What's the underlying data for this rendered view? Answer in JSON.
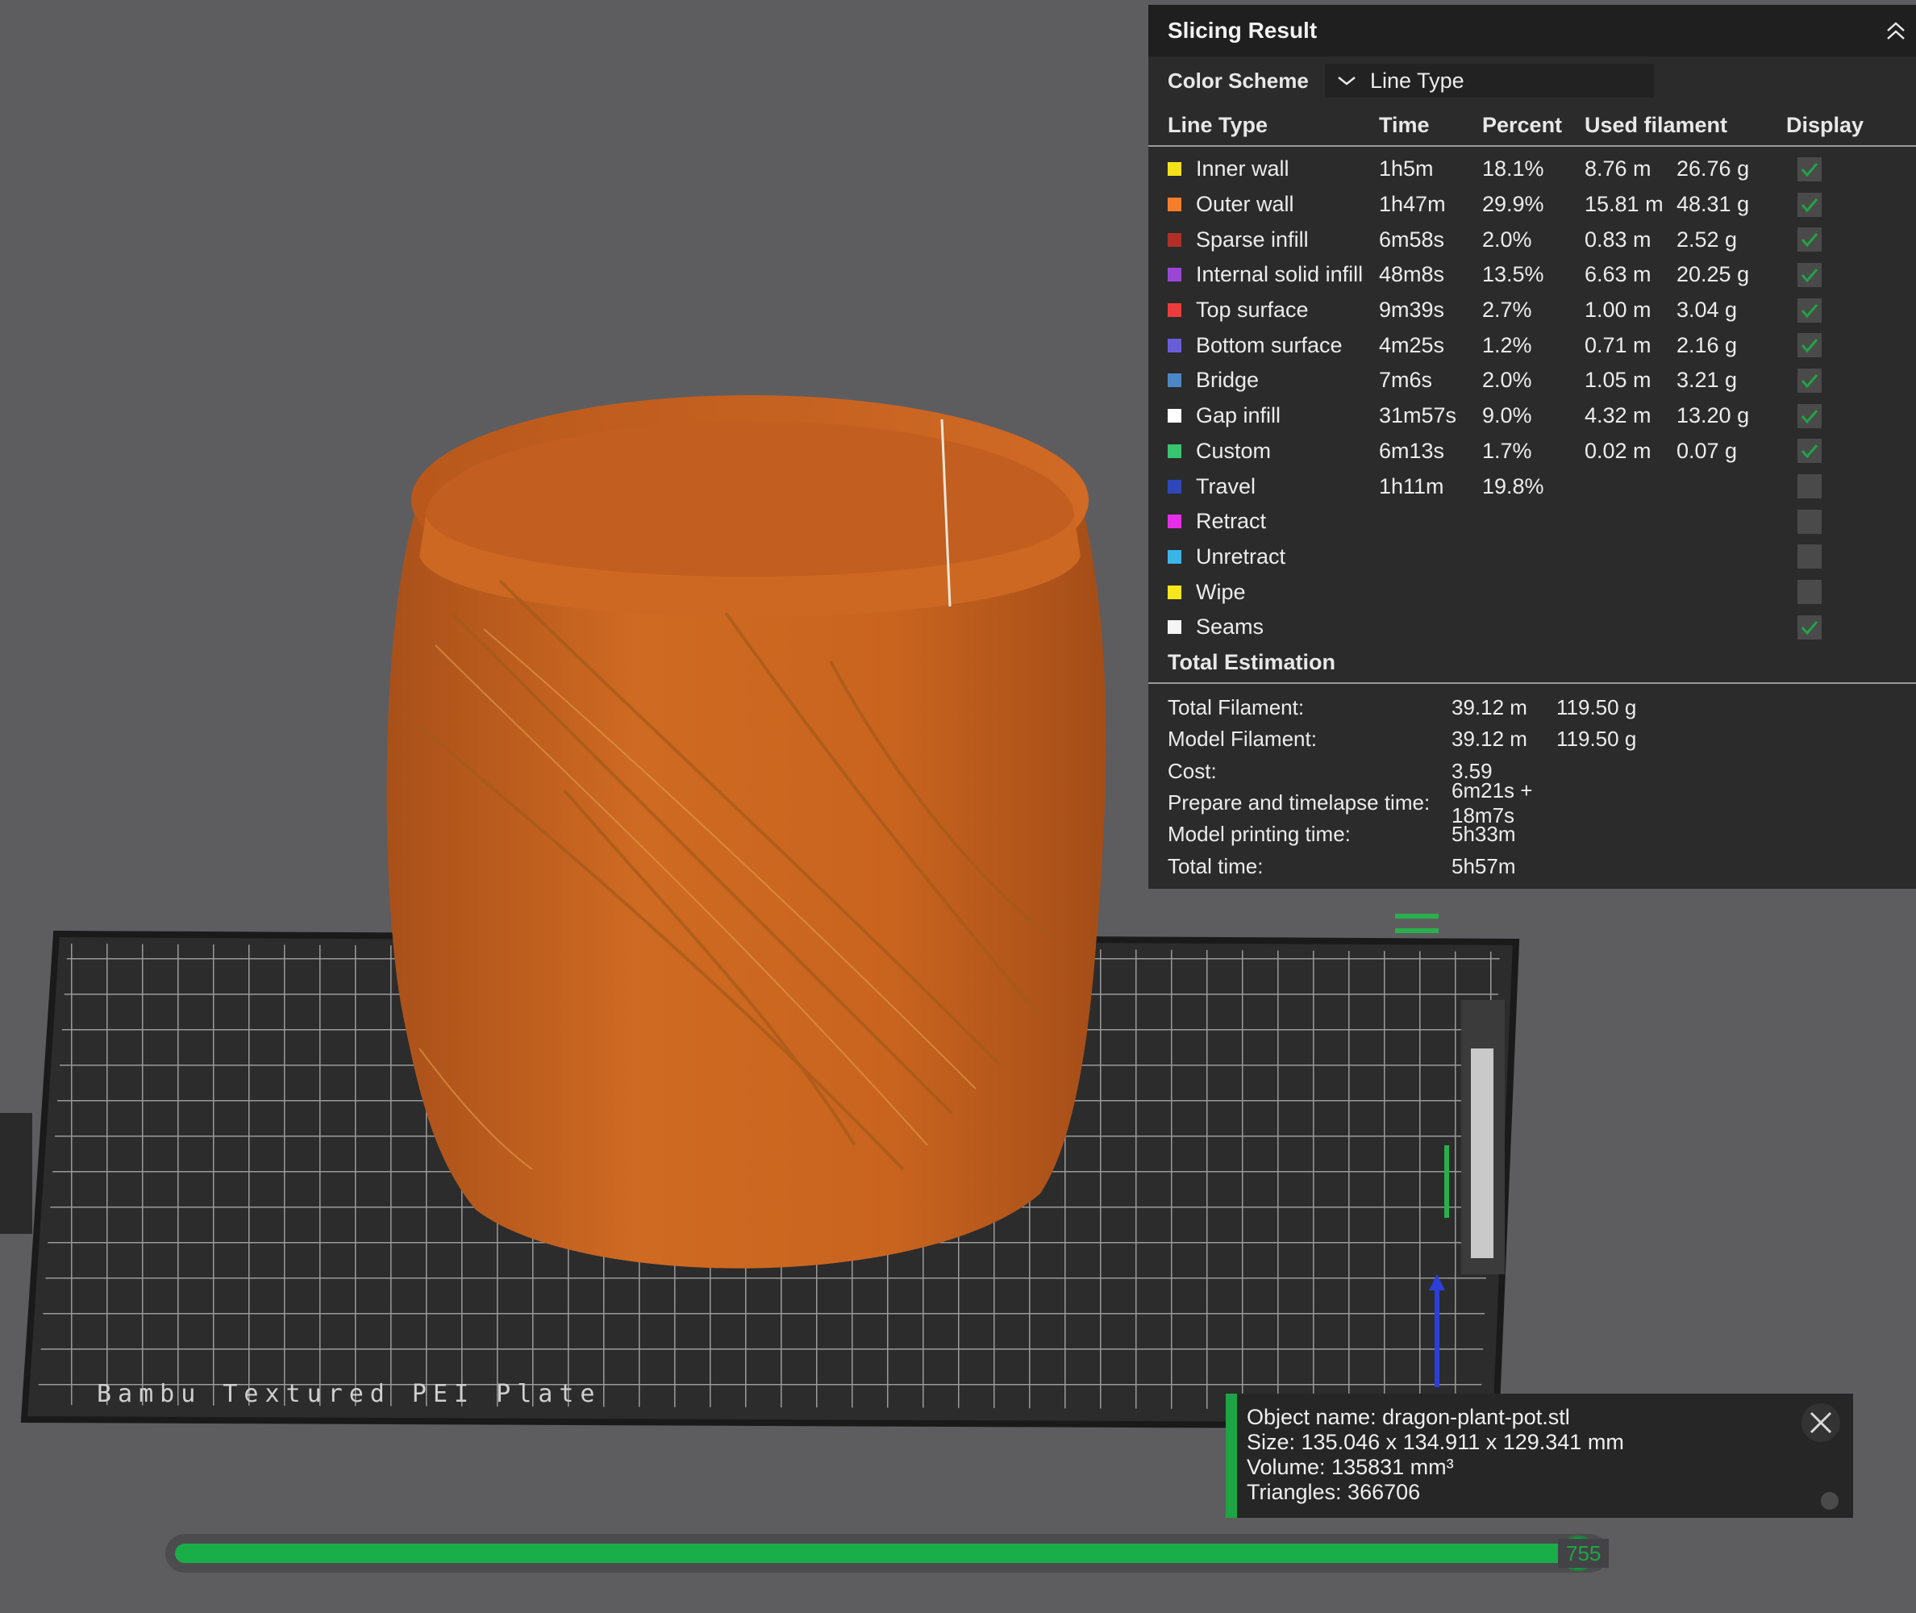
{
  "panel": {
    "title": "Slicing Result",
    "color_scheme_label": "Color Scheme",
    "color_scheme_value": "Line Type",
    "columns": {
      "line_type": "Line Type",
      "time": "Time",
      "percent": "Percent",
      "used_filament": "Used filament",
      "display": "Display"
    },
    "rows": [
      {
        "name": "Inner wall",
        "time": "1h5m",
        "percent": "18.1%",
        "length": "8.76 m",
        "weight": "26.76 g",
        "color": "#f3e21b",
        "checked": true
      },
      {
        "name": "Outer wall",
        "time": "1h47m",
        "percent": "29.9%",
        "length": "15.81 m",
        "weight": "48.31 g",
        "color": "#f47e2a",
        "checked": true
      },
      {
        "name": "Sparse infill",
        "time": "6m58s",
        "percent": "2.0%",
        "length": "0.83 m",
        "weight": "2.52 g",
        "color": "#b03028",
        "checked": true
      },
      {
        "name": "Internal solid infill",
        "time": "48m8s",
        "percent": "13.5%",
        "length": "6.63 m",
        "weight": "20.25 g",
        "color": "#9a47d6",
        "checked": true
      },
      {
        "name": "Top surface",
        "time": "9m39s",
        "percent": "2.7%",
        "length": "1.00 m",
        "weight": "3.04 g",
        "color": "#ec3c3c",
        "checked": true
      },
      {
        "name": "Bottom surface",
        "time": "4m25s",
        "percent": "1.2%",
        "length": "0.71 m",
        "weight": "2.16 g",
        "color": "#6a5ed8",
        "checked": true
      },
      {
        "name": "Bridge",
        "time": "7m6s",
        "percent": "2.0%",
        "length": "1.05 m",
        "weight": "3.21 g",
        "color": "#4d86c6",
        "checked": true
      },
      {
        "name": "Gap infill",
        "time": "31m57s",
        "percent": "9.0%",
        "length": "4.32 m",
        "weight": "13.20 g",
        "color": "#ffffff",
        "checked": true
      },
      {
        "name": "Custom",
        "time": "6m13s",
        "percent": "1.7%",
        "length": "0.02 m",
        "weight": "0.07 g",
        "color": "#38c470",
        "checked": true
      },
      {
        "name": "Travel",
        "time": "1h11m",
        "percent": "19.8%",
        "length": "",
        "weight": "",
        "color": "#2f47b8",
        "checked": false
      },
      {
        "name": "Retract",
        "time": "",
        "percent": "",
        "length": "",
        "weight": "",
        "color": "#e52ee5",
        "checked": false
      },
      {
        "name": "Unretract",
        "time": "",
        "percent": "",
        "length": "",
        "weight": "",
        "color": "#3bb5e5",
        "checked": false
      },
      {
        "name": "Wipe",
        "time": "",
        "percent": "",
        "length": "",
        "weight": "",
        "color": "#f6e61b",
        "checked": false
      },
      {
        "name": "Seams",
        "time": "",
        "percent": "",
        "length": "",
        "weight": "",
        "color": "#f5f5f5",
        "checked": true
      }
    ],
    "estimation_title": "Total Estimation",
    "estimation": [
      {
        "label": "Total Filament:",
        "v1": "39.12 m",
        "v2": "119.50 g"
      },
      {
        "label": "Model Filament:",
        "v1": "39.12 m",
        "v2": "119.50 g"
      },
      {
        "label": "Cost:",
        "v1": "3.59",
        "v2": ""
      },
      {
        "label": "Prepare and timelapse time:",
        "v1": "6m21s + 18m7s",
        "v2": ""
      },
      {
        "label": "Model printing time:",
        "v1": "5h33m",
        "v2": ""
      },
      {
        "label": "Total time:",
        "v1": "5h57m",
        "v2": ""
      }
    ]
  },
  "object_info": {
    "name_line": "Object name: dragon-plant-pot.stl",
    "size_line": "Size: 135.046 x 134.911 x 129.341 mm",
    "volume_line": "Volume: 135831 mm³",
    "triangles_line": "Triangles: 366706"
  },
  "plate": {
    "label": "Bambu Textured PEI Plate"
  },
  "layer_slider": {
    "value": "755",
    "fraction": 0.985
  },
  "colors": {
    "accent": "#1fa445",
    "model": "#c8621e",
    "panel_bg": "#2b2b2b",
    "viewport_bg": "#5d5d60"
  },
  "icons": {
    "collapse": "chevron-up-icon",
    "dropdown": "chevron-down-icon",
    "check": "check-icon",
    "close": "close-icon"
  }
}
